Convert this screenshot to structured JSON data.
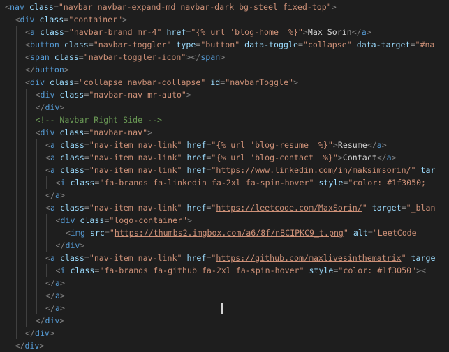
{
  "editor": {
    "lines": [
      {
        "indent": 0,
        "tokens": [
          [
            "p",
            "<"
          ],
          [
            "t",
            "nav"
          ],
          [
            "x",
            " "
          ],
          [
            "a",
            "class"
          ],
          [
            "p",
            "="
          ],
          [
            "s",
            "\"navbar navbar-expand-md navbar-dark bg-steel fixed-top\""
          ],
          [
            "p",
            ">"
          ]
        ]
      },
      {
        "indent": 1,
        "tokens": [
          [
            "p",
            "<"
          ],
          [
            "t",
            "div"
          ],
          [
            "x",
            " "
          ],
          [
            "a",
            "class"
          ],
          [
            "p",
            "="
          ],
          [
            "s",
            "\"container\""
          ],
          [
            "p",
            ">"
          ]
        ]
      },
      {
        "indent": 2,
        "tokens": [
          [
            "p",
            "<"
          ],
          [
            "t",
            "a"
          ],
          [
            "x",
            " "
          ],
          [
            "a",
            "class"
          ],
          [
            "p",
            "="
          ],
          [
            "s",
            "\"navbar-brand mr-4\""
          ],
          [
            "x",
            " "
          ],
          [
            "a",
            "href"
          ],
          [
            "p",
            "="
          ],
          [
            "s",
            "\"{% url 'blog-home' %}\""
          ],
          [
            "p",
            ">"
          ],
          [
            "x",
            "Max Sorin"
          ],
          [
            "p",
            "</"
          ],
          [
            "t",
            "a"
          ],
          [
            "p",
            ">"
          ]
        ]
      },
      {
        "indent": 2,
        "tokens": [
          [
            "p",
            "<"
          ],
          [
            "t",
            "button"
          ],
          [
            "x",
            " "
          ],
          [
            "a",
            "class"
          ],
          [
            "p",
            "="
          ],
          [
            "s",
            "\"navbar-toggler\""
          ],
          [
            "x",
            " "
          ],
          [
            "a",
            "type"
          ],
          [
            "p",
            "="
          ],
          [
            "s",
            "\"button\""
          ],
          [
            "x",
            " "
          ],
          [
            "a",
            "data-toggle"
          ],
          [
            "p",
            "="
          ],
          [
            "s",
            "\"collapse\""
          ],
          [
            "x",
            " "
          ],
          [
            "a",
            "data-target"
          ],
          [
            "p",
            "="
          ],
          [
            "s",
            "\"#na"
          ]
        ]
      },
      {
        "indent": 2,
        "tokens": [
          [
            "p",
            "<"
          ],
          [
            "t",
            "span"
          ],
          [
            "x",
            " "
          ],
          [
            "a",
            "class"
          ],
          [
            "p",
            "="
          ],
          [
            "s",
            "\"navbar-toggler-icon\""
          ],
          [
            "p",
            "></"
          ],
          [
            "t",
            "span"
          ],
          [
            "p",
            ">"
          ]
        ]
      },
      {
        "indent": 2,
        "tokens": [
          [
            "p",
            "</"
          ],
          [
            "t",
            "button"
          ],
          [
            "p",
            ">"
          ]
        ]
      },
      {
        "indent": 2,
        "tokens": [
          [
            "p",
            "<"
          ],
          [
            "t",
            "div"
          ],
          [
            "x",
            " "
          ],
          [
            "a",
            "class"
          ],
          [
            "p",
            "="
          ],
          [
            "s",
            "\"collapse navbar-collapse\""
          ],
          [
            "x",
            " "
          ],
          [
            "a",
            "id"
          ],
          [
            "p",
            "="
          ],
          [
            "s",
            "\"navbarToggle\""
          ],
          [
            "p",
            ">"
          ]
        ]
      },
      {
        "indent": 3,
        "tokens": [
          [
            "p",
            "<"
          ],
          [
            "t",
            "div"
          ],
          [
            "x",
            " "
          ],
          [
            "a",
            "class"
          ],
          [
            "p",
            "="
          ],
          [
            "s",
            "\"navbar-nav mr-auto\""
          ],
          [
            "p",
            ">"
          ]
        ]
      },
      {
        "indent": 3,
        "tokens": [
          [
            "p",
            "</"
          ],
          [
            "t",
            "div"
          ],
          [
            "p",
            ">"
          ]
        ]
      },
      {
        "indent": 3,
        "tokens": [
          [
            "c",
            "<!-- Navbar Right Side -->"
          ]
        ]
      },
      {
        "indent": 3,
        "tokens": [
          [
            "p",
            "<"
          ],
          [
            "t",
            "div"
          ],
          [
            "x",
            " "
          ],
          [
            "a",
            "class"
          ],
          [
            "p",
            "="
          ],
          [
            "s",
            "\"navbar-nav\""
          ],
          [
            "p",
            ">"
          ]
        ]
      },
      {
        "indent": 4,
        "tokens": [
          [
            "p",
            "<"
          ],
          [
            "t",
            "a"
          ],
          [
            "x",
            " "
          ],
          [
            "a",
            "class"
          ],
          [
            "p",
            "="
          ],
          [
            "s",
            "\"nav-item nav-link\""
          ],
          [
            "x",
            " "
          ],
          [
            "a",
            "href"
          ],
          [
            "p",
            "="
          ],
          [
            "s",
            "\"{% url 'blog-resume' %}\""
          ],
          [
            "p",
            ">"
          ],
          [
            "x",
            "Resume"
          ],
          [
            "p",
            "</"
          ],
          [
            "t",
            "a"
          ],
          [
            "p",
            ">"
          ]
        ]
      },
      {
        "indent": 4,
        "tokens": [
          [
            "p",
            "<"
          ],
          [
            "t",
            "a"
          ],
          [
            "x",
            " "
          ],
          [
            "a",
            "class"
          ],
          [
            "p",
            "="
          ],
          [
            "s",
            "\"nav-item nav-link\""
          ],
          [
            "x",
            " "
          ],
          [
            "a",
            "href"
          ],
          [
            "p",
            "="
          ],
          [
            "s",
            "\"{% url 'blog-contact' %}\""
          ],
          [
            "p",
            ">"
          ],
          [
            "x",
            "Contact"
          ],
          [
            "p",
            "</"
          ],
          [
            "t",
            "a"
          ],
          [
            "p",
            ">"
          ]
        ]
      },
      {
        "indent": 4,
        "tokens": [
          [
            "p",
            "<"
          ],
          [
            "t",
            "a"
          ],
          [
            "x",
            " "
          ],
          [
            "a",
            "class"
          ],
          [
            "p",
            "="
          ],
          [
            "s",
            "\"nav-item nav-link\""
          ],
          [
            "x",
            " "
          ],
          [
            "a",
            "href"
          ],
          [
            "p",
            "="
          ],
          [
            "s",
            "\""
          ],
          [
            "u",
            "https://www.linkedin.com/in/maksimsorin/"
          ],
          [
            "s",
            "\""
          ],
          [
            "x",
            " "
          ],
          [
            "a",
            "tar"
          ]
        ]
      },
      {
        "indent": 5,
        "tokens": [
          [
            "p",
            "<"
          ],
          [
            "t",
            "i"
          ],
          [
            "x",
            " "
          ],
          [
            "a",
            "class"
          ],
          [
            "p",
            "="
          ],
          [
            "s",
            "\"fa-brands fa-linkedin fa-2xl fa-spin-hover\""
          ],
          [
            "x",
            " "
          ],
          [
            "a",
            "style"
          ],
          [
            "p",
            "="
          ],
          [
            "s",
            "\"color: #1f3050;"
          ]
        ]
      },
      {
        "indent": 4,
        "tokens": [
          [
            "p",
            "</"
          ],
          [
            "t",
            "a"
          ],
          [
            "p",
            ">"
          ]
        ]
      },
      {
        "indent": 4,
        "tokens": [
          [
            "p",
            "<"
          ],
          [
            "t",
            "a"
          ],
          [
            "x",
            " "
          ],
          [
            "a",
            "class"
          ],
          [
            "p",
            "="
          ],
          [
            "s",
            "\"nav-item nav-link\""
          ],
          [
            "x",
            " "
          ],
          [
            "a",
            "href"
          ],
          [
            "p",
            "="
          ],
          [
            "s",
            "\""
          ],
          [
            "u",
            "https://leetcode.com/MaxSorin/"
          ],
          [
            "s",
            "\""
          ],
          [
            "x",
            " "
          ],
          [
            "a",
            "target"
          ],
          [
            "p",
            "="
          ],
          [
            "s",
            "\"_blan"
          ]
        ]
      },
      {
        "indent": 5,
        "tokens": [
          [
            "p",
            "<"
          ],
          [
            "t",
            "div"
          ],
          [
            "x",
            " "
          ],
          [
            "a",
            "class"
          ],
          [
            "p",
            "="
          ],
          [
            "s",
            "\"logo-container\""
          ],
          [
            "p",
            ">"
          ]
        ]
      },
      {
        "indent": 6,
        "tokens": [
          [
            "p",
            "<"
          ],
          [
            "t",
            "img"
          ],
          [
            "x",
            " "
          ],
          [
            "a",
            "src"
          ],
          [
            "p",
            "="
          ],
          [
            "s",
            "\""
          ],
          [
            "u",
            "https://thumbs2.imgbox.com/a6/8f/nBCIPKC9_t.png"
          ],
          [
            "s",
            "\""
          ],
          [
            "x",
            " "
          ],
          [
            "a",
            "alt"
          ],
          [
            "p",
            "="
          ],
          [
            "s",
            "\"LeetCode"
          ]
        ]
      },
      {
        "indent": 5,
        "tokens": [
          [
            "p",
            "</"
          ],
          [
            "t",
            "div"
          ],
          [
            "p",
            ">"
          ]
        ]
      },
      {
        "indent": 4,
        "tokens": [
          [
            "p",
            "<"
          ],
          [
            "t",
            "a"
          ],
          [
            "x",
            " "
          ],
          [
            "a",
            "class"
          ],
          [
            "p",
            "="
          ],
          [
            "s",
            "\"nav-item nav-link\""
          ],
          [
            "x",
            " "
          ],
          [
            "a",
            "href"
          ],
          [
            "p",
            "="
          ],
          [
            "s",
            "\""
          ],
          [
            "u",
            "https://github.com/maxlivesinthematrix"
          ],
          [
            "s",
            "\""
          ],
          [
            "x",
            " "
          ],
          [
            "a",
            "targe"
          ]
        ]
      },
      {
        "indent": 5,
        "tokens": [
          [
            "p",
            "<"
          ],
          [
            "t",
            "i"
          ],
          [
            "x",
            " "
          ],
          [
            "a",
            "class"
          ],
          [
            "p",
            "="
          ],
          [
            "s",
            "\"fa-brands fa-github fa-2xl fa-spin-hover\""
          ],
          [
            "x",
            " "
          ],
          [
            "a",
            "style"
          ],
          [
            "p",
            "="
          ],
          [
            "s",
            "\"color: #1f3050\""
          ],
          [
            "p",
            "><"
          ]
        ]
      },
      {
        "indent": 4,
        "tokens": [
          [
            "p",
            "</"
          ],
          [
            "t",
            "a"
          ],
          [
            "p",
            ">"
          ]
        ]
      },
      {
        "indent": 4,
        "tokens": [
          [
            "p",
            "</"
          ],
          [
            "t",
            "a"
          ],
          [
            "p",
            ">"
          ]
        ]
      },
      {
        "indent": 4,
        "tokens": [
          [
            "p",
            "</"
          ],
          [
            "t",
            "a"
          ],
          [
            "p",
            ">"
          ]
        ]
      },
      {
        "indent": 3,
        "tokens": [
          [
            "p",
            "</"
          ],
          [
            "t",
            "div"
          ],
          [
            "p",
            ">"
          ]
        ]
      },
      {
        "indent": 2,
        "tokens": [
          [
            "p",
            "</"
          ],
          [
            "t",
            "div"
          ],
          [
            "p",
            ">"
          ]
        ]
      },
      {
        "indent": 1,
        "tokens": [
          [
            "p",
            "</"
          ],
          [
            "t",
            "div"
          ],
          [
            "p",
            ">"
          ]
        ]
      }
    ],
    "colors": {
      "background": "#1e1e1e",
      "tag": "#569cd6",
      "attribute": "#9cdcfe",
      "string": "#ce9178",
      "punctuation": "#808080",
      "text": "#d4d4d4",
      "comment": "#6a9955",
      "indent_guide": "#404040"
    }
  }
}
